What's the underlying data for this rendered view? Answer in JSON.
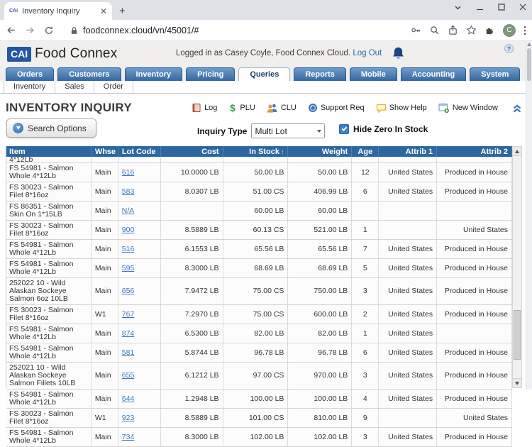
{
  "browser": {
    "tab_title": "Inventory Inquiry",
    "favicon_text": "CAi",
    "url": "foodconnex.cloud/vn/45001/#",
    "avatar_letter": "C"
  },
  "header": {
    "logo_badge": "CAI",
    "logo_name": "Food Connex",
    "login_text": "Logged in as Casey Coyle, Food Connex Cloud.",
    "logout_label": "Log Out"
  },
  "nav": {
    "tabs": [
      "Orders",
      "Customers",
      "Inventory",
      "Pricing",
      "Queries",
      "Reports",
      "Mobile",
      "Accounting",
      "System"
    ],
    "active_tab": "Queries",
    "sub_tabs": [
      "Inventory",
      "Sales",
      "Order"
    ]
  },
  "page": {
    "title": "INVENTORY INQUIRY",
    "toolbar": [
      {
        "icon": "log-icon",
        "label": "Log"
      },
      {
        "icon": "plu-icon",
        "label": "PLU"
      },
      {
        "icon": "clu-icon",
        "label": "CLU"
      },
      {
        "icon": "support-req-icon",
        "label": "Support Req"
      },
      {
        "icon": "show-help-icon",
        "label": "Show Help"
      },
      {
        "icon": "new-window-icon",
        "label": "New Window"
      }
    ],
    "search_options_label": "Search Options",
    "inquiry_type_label": "Inquiry Type",
    "inquiry_type_value": "Multi Lot",
    "hide_zero_label": "Hide Zero In Stock",
    "hide_zero_checked": true
  },
  "table": {
    "columns": [
      "Item",
      "Whse",
      "Lot Code",
      "Cost",
      "In Stock",
      "Weight",
      "Age",
      "Attrib 1",
      "Attrib 2"
    ],
    "sort_column": "In Stock",
    "sort_direction": "asc",
    "partial_row_fragment": "4*12Lb",
    "rows": [
      {
        "item": "FS 54981 - Salmon Whole 4*12Lb",
        "whse": "Main",
        "lot": "616",
        "cost": "10.0000 LB",
        "in_stock": "50.00 LB",
        "weight": "50.00 LB",
        "age": "12",
        "attrib1": "United States",
        "attrib2": "Produced in House"
      },
      {
        "item": "FS 30023 - Salmon Filet 8*16oz",
        "whse": "Main",
        "lot": "583",
        "cost": "8.0307 LB",
        "in_stock": "51.00 CS",
        "weight": "406.99 LB",
        "age": "6",
        "attrib1": "United States",
        "attrib2": "Produced in House"
      },
      {
        "item": "FS 86351 - Salmon Skin On 1*15LB",
        "whse": "Main",
        "lot": "N/A",
        "cost": "",
        "in_stock": "60.00 LB",
        "weight": "60.00 LB",
        "age": "",
        "attrib1": "",
        "attrib2": ""
      },
      {
        "item": "FS 30023 - Salmon Filet 8*16oz",
        "whse": "Main",
        "lot": "900",
        "cost": "8.5889 LB",
        "in_stock": "60.13 CS",
        "weight": "521.00 LB",
        "age": "1",
        "attrib1": "",
        "attrib2": "United States"
      },
      {
        "item": "FS 54981 - Salmon Whole 4*12Lb",
        "whse": "Main",
        "lot": "516",
        "cost": "6.1553 LB",
        "in_stock": "65.56 LB",
        "weight": "65.56 LB",
        "age": "7",
        "attrib1": "United States",
        "attrib2": "Produced in House"
      },
      {
        "item": "FS 54981 - Salmon Whole 4*12Lb",
        "whse": "Main",
        "lot": "595",
        "cost": "8.3000 LB",
        "in_stock": "68.69 LB",
        "weight": "68.69 LB",
        "age": "5",
        "attrib1": "United States",
        "attrib2": "Produced in House"
      },
      {
        "item": "252022 10 - Wild Alaskan Sockeye Salmon 6oz 10LB",
        "whse": "Main",
        "lot": "656",
        "cost": "7.9472 LB",
        "in_stock": "75.00 CS",
        "weight": "750.00 LB",
        "age": "3",
        "attrib1": "United States",
        "attrib2": "Produced in House"
      },
      {
        "item": "FS 30023 - Salmon Filet 8*16oz",
        "whse": "W1",
        "lot": "767",
        "cost": "7.2970 LB",
        "in_stock": "75.00 CS",
        "weight": "600.00 LB",
        "age": "2",
        "attrib1": "United States",
        "attrib2": "Produced in House"
      },
      {
        "item": "FS 54981 - Salmon Whole 4*12Lb",
        "whse": "Main",
        "lot": "874",
        "cost": "6.5300 LB",
        "in_stock": "82.00 LB",
        "weight": "82.00 LB",
        "age": "1",
        "attrib1": "United States",
        "attrib2": ""
      },
      {
        "item": "FS 54981 - Salmon Whole 4*12Lb",
        "whse": "Main",
        "lot": "581",
        "cost": "5.8744 LB",
        "in_stock": "96.78 LB",
        "weight": "96.78 LB",
        "age": "6",
        "attrib1": "United States",
        "attrib2": "Produced in House"
      },
      {
        "item": "252021 10 - Wild Alaskan Sockeye Salmon Fillets 10LB",
        "whse": "Main",
        "lot": "655",
        "cost": "6.1212 LB",
        "in_stock": "97.00 CS",
        "weight": "970.00 LB",
        "age": "3",
        "attrib1": "United States",
        "attrib2": "Produced in House"
      },
      {
        "item": "FS 54981 - Salmon Whole 4*12Lb",
        "whse": "Main",
        "lot": "644",
        "cost": "1.2948 LB",
        "in_stock": "100.00 LB",
        "weight": "100.00 LB",
        "age": "4",
        "attrib1": "United States",
        "attrib2": "Produced in House"
      },
      {
        "item": "FS 30023 - Salmon Filet 8*16oz",
        "whse": "W1",
        "lot": "923",
        "cost": "8.5889 LB",
        "in_stock": "101.00 CS",
        "weight": "810.00 LB",
        "age": "9",
        "attrib1": "",
        "attrib2": "United States"
      },
      {
        "item": "FS 54981 - Salmon Whole 4*12Lb",
        "whse": "Main",
        "lot": "734",
        "cost": "8.3000 LB",
        "in_stock": "102.00 LB",
        "weight": "102.00 LB",
        "age": "3",
        "attrib1": "United States",
        "attrib2": "Produced in House"
      }
    ]
  },
  "colors": {
    "nav_tab_blue": "#35689f",
    "table_header_blue": "#2d67a1",
    "link_blue": "#3c78b8",
    "accent_blue": "#3f7fc1",
    "checkbox_blue": "#3c82cc",
    "logo_blue": "#2456a4"
  }
}
